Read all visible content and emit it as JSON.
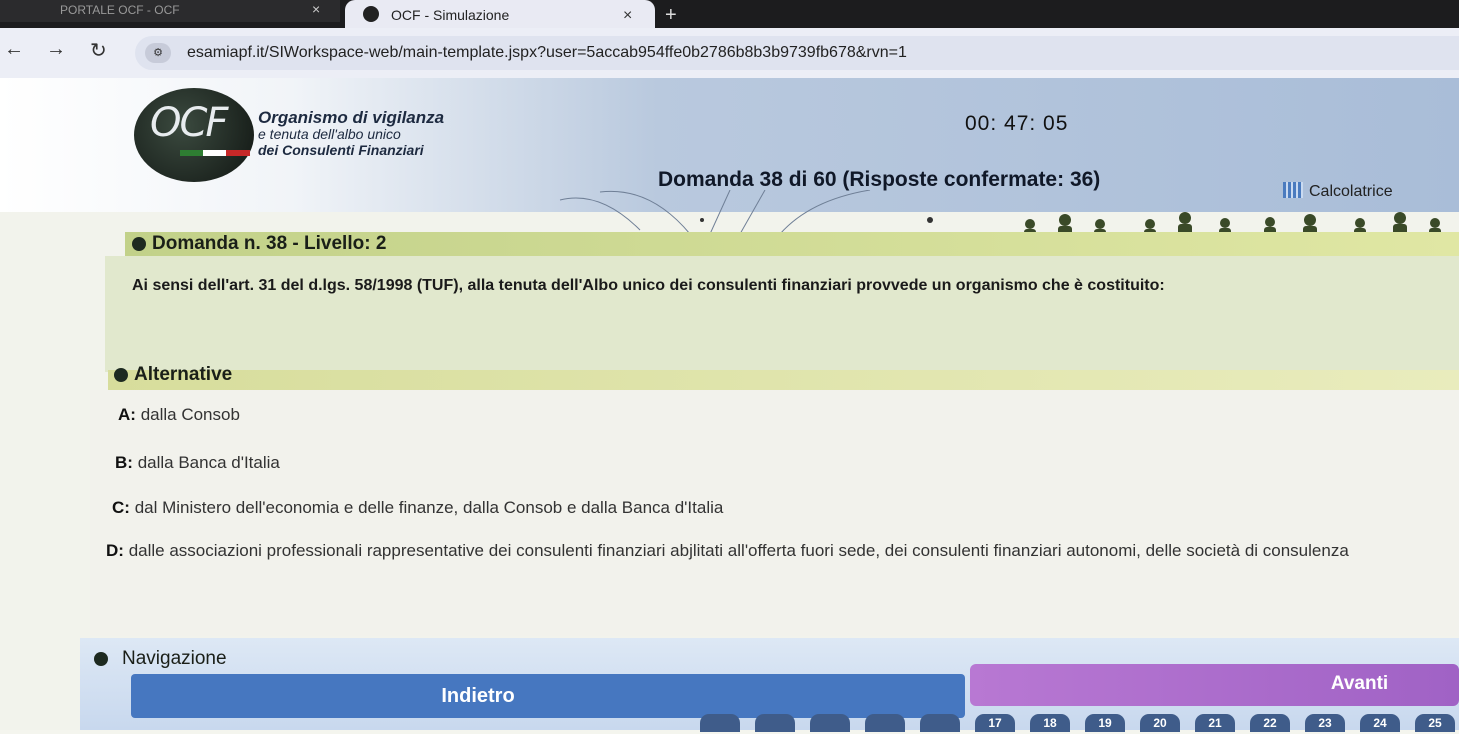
{
  "browser": {
    "prev_tab_title": "PORTALE OCF - OCF",
    "active_tab_title": "OCF - Simulazione",
    "close_glyph": "×",
    "new_tab_glyph": "+",
    "url": "esamiapf.it/SIWorkspace-web/main-template.jspx?user=5accab954ffe0b2786b8b3b9739fb678&rvn=1"
  },
  "header": {
    "logo_text": "OCF",
    "org_line1": "Organismo di vigilanza",
    "org_line2": "e tenuta dell'albo unico",
    "org_line3": "dei Consulenti Finanziari",
    "timer": "00: 47: 05",
    "question_counter": "Domanda 38 di 60 (Risposte confermate: 36)",
    "calculator_label": "Calcolatrice"
  },
  "question": {
    "heading": "Domanda n. 38 - Livello: 2",
    "text": "Ai sensi dell'art. 31 del d.lgs. 58/1998 (TUF), alla tenuta dell'Albo unico dei consulenti finanziari provvede un organismo che è costituito:"
  },
  "alternatives": {
    "heading": "Alternative",
    "items": [
      {
        "letter": "A:",
        "text": "dalla Consob"
      },
      {
        "letter": "B:",
        "text": "dalla Banca d'Italia"
      },
      {
        "letter": "C:",
        "text": "dal Ministero dell'economia e delle finanze, dalla Consob e dalla Banca d'Italia"
      },
      {
        "letter": "D:",
        "text": "dalle associazioni professionali rappresentative dei consulenti finanziari abjlitati all'offerta fuori sede, dei consulenti finanziari autonomi, delle società di consulenza"
      }
    ]
  },
  "navigation": {
    "heading": "Navigazione",
    "back_label": "Indietro",
    "next_label": "Avanti",
    "pages": [
      "",
      "",
      "",
      "",
      "",
      "17",
      "18",
      "19",
      "20",
      "21",
      "22",
      "23",
      "24",
      "25"
    ]
  },
  "colors": {
    "back_button": "#4677c0",
    "next_button": "#b878d3",
    "question_bar": "#c2d189"
  }
}
